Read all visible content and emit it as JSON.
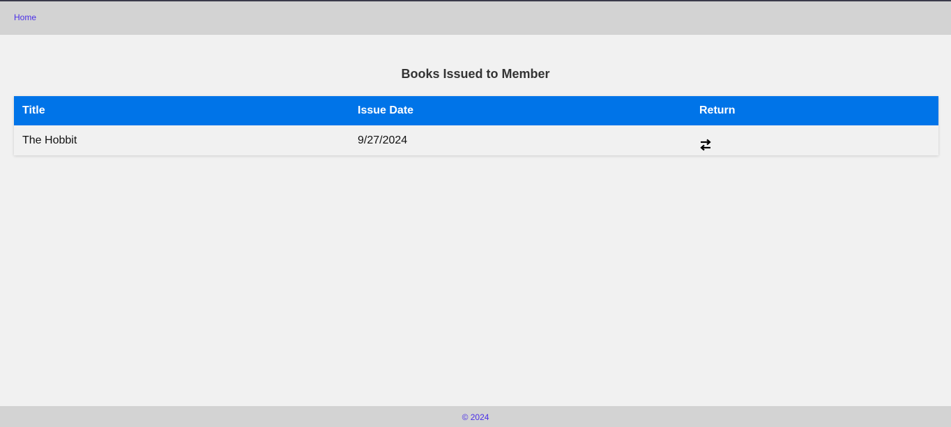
{
  "nav": {
    "home_label": "Home"
  },
  "main": {
    "title": "Books Issued to Member",
    "table": {
      "headers": [
        "Title",
        "Issue Date",
        "Return"
      ],
      "rows": [
        {
          "title": "The Hobbit",
          "issue_date": "9/27/2024",
          "return_icon": "swap-arrows-icon"
        }
      ]
    }
  },
  "footer": {
    "text": "© 2024"
  },
  "colors": {
    "header_bg": "#0074e8",
    "topbar_bg": "#d3d3d3",
    "link": "#4a2ee8",
    "page_bg": "#f1f1f1"
  }
}
